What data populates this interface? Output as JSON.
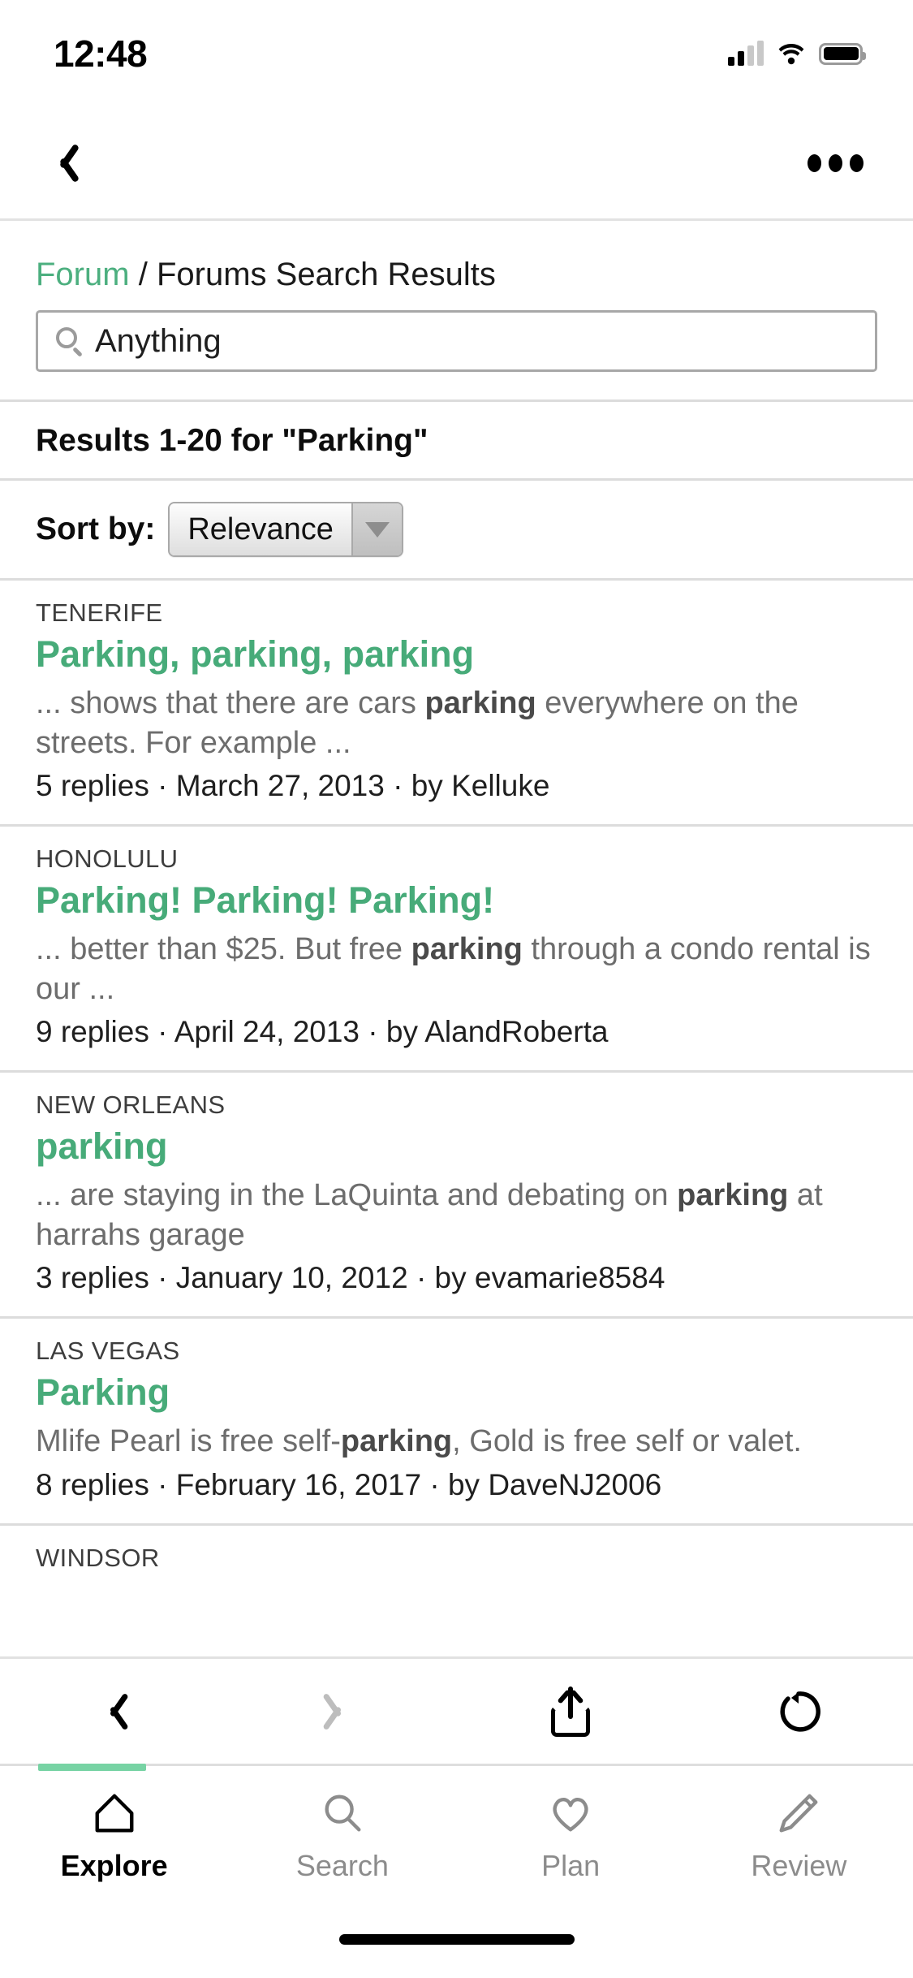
{
  "status_bar": {
    "time": "12:48",
    "signal_icon": "cellular-signal-icon",
    "wifi_icon": "wifi-icon",
    "battery_icon": "battery-icon"
  },
  "browser_top_nav": {
    "back_icon": "chevron-left-icon",
    "more_icon": "ellipsis-icon"
  },
  "page": {
    "breadcrumb": {
      "link": "Forum",
      "separator": "/",
      "current": "Forums Search Results"
    },
    "search": {
      "icon": "search-icon",
      "value": "Anything",
      "placeholder": "Anything"
    },
    "results_header": "Results 1-20 for \"Parking\"",
    "sort": {
      "label": "Sort by:",
      "selected": "Relevance",
      "options": [
        "Relevance"
      ],
      "arrow_icon": "chevron-down-icon"
    },
    "results": [
      {
        "location": "TENERIFE",
        "title": "Parking, parking, parking",
        "snippet_before": "... shows that there are cars ",
        "snippet_highlight": "parking",
        "snippet_after": " everywhere on the streets. For example ...",
        "meta": "5 replies · March 27, 2013 · by Kelluke"
      },
      {
        "location": "HONOLULU",
        "title": "Parking! Parking! Parking!",
        "snippet_before": "... better than $25. But free ",
        "snippet_highlight": "parking",
        "snippet_after": " through a condo rental is our ...",
        "meta": "9 replies · April 24, 2013 · by AlandRoberta"
      },
      {
        "location": "NEW ORLEANS",
        "title": "parking",
        "snippet_before": "... are staying in the LaQuinta and debating on ",
        "snippet_highlight": "parking",
        "snippet_after": " at harrahs garage",
        "meta": "3 replies · January 10, 2012 · by evamarie8584"
      },
      {
        "location": "LAS VEGAS",
        "title": "Parking",
        "snippet_before": "Mlife Pearl is free self-",
        "snippet_highlight": "parking",
        "snippet_after": ", Gold is free self or valet.",
        "meta": "8 replies · February 16, 2017 · by DaveNJ2006"
      },
      {
        "location": "WINDSOR",
        "title": "",
        "snippet_before": "",
        "snippet_highlight": "",
        "snippet_after": "",
        "meta": ""
      }
    ]
  },
  "browser_bottom_toolbar": {
    "back_icon": "chevron-left-icon",
    "forward_icon": "chevron-right-icon",
    "share_icon": "share-icon",
    "reload_icon": "reload-icon"
  },
  "tab_bar": {
    "active_index": 0,
    "items": [
      {
        "label": "Explore",
        "icon": "home-icon"
      },
      {
        "label": "Search",
        "icon": "search-icon"
      },
      {
        "label": "Plan",
        "icon": "heart-icon"
      },
      {
        "label": "Review",
        "icon": "pencil-icon"
      }
    ]
  },
  "colors": {
    "accent_green": "#47ab79",
    "tab_indicator_green": "#77d3a4",
    "divider": "#dcdcdc",
    "muted_text": "#6d6d6d"
  }
}
